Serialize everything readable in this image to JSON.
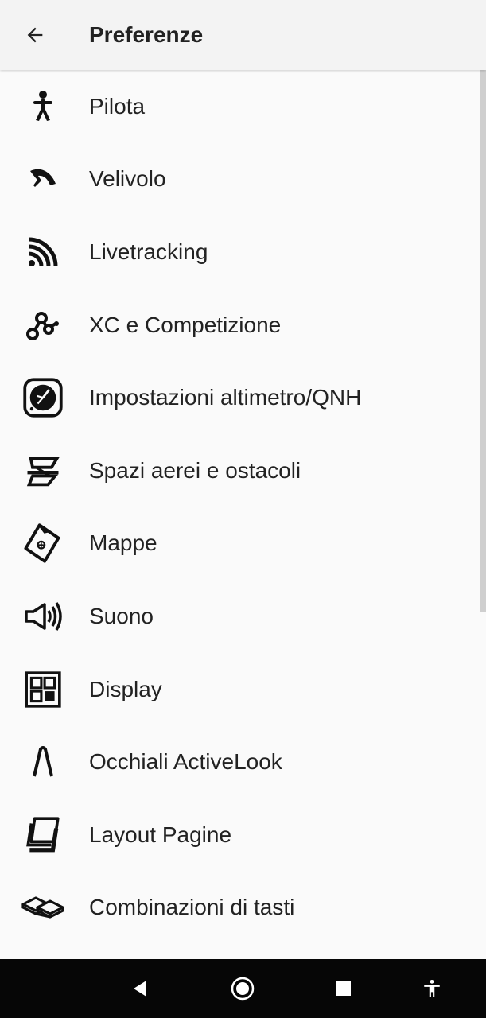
{
  "header": {
    "title": "Preferenze",
    "back_icon": "arrow-left-icon"
  },
  "menu": {
    "items": [
      {
        "label": "Pilota",
        "icon": "pilot-icon"
      },
      {
        "label": "Velivolo",
        "icon": "glider-icon"
      },
      {
        "label": "Livetracking",
        "icon": "rss-signal-icon"
      },
      {
        "label": "XC e Competizione",
        "icon": "route-nodes-icon"
      },
      {
        "label": "Impostazioni altimetro/QNH",
        "icon": "altimeter-icon"
      },
      {
        "label": "Spazi aerei e ostacoli",
        "icon": "airspace-icon"
      },
      {
        "label": "Mappe",
        "icon": "map-icon"
      },
      {
        "label": "Suono",
        "icon": "speaker-icon"
      },
      {
        "label": "Display",
        "icon": "display-grid-icon"
      },
      {
        "label": "Occhiali ActiveLook",
        "icon": "glasses-icon"
      },
      {
        "label": "Layout Pagine",
        "icon": "pages-layout-icon"
      },
      {
        "label": "Combinazioni di tasti",
        "icon": "keys-icon"
      }
    ]
  },
  "system_nav": {
    "back_icon": "nav-back-icon",
    "home_icon": "nav-home-icon",
    "recents_icon": "nav-recents-icon",
    "accessibility_icon": "accessibility-icon"
  },
  "colors": {
    "background": "#fafafa",
    "appbar": "#f3f3f3",
    "text": "#222222",
    "navbar": "#060606"
  }
}
